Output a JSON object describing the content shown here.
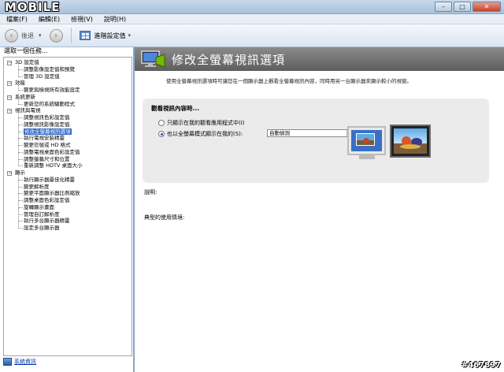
{
  "window": {
    "watermark": "MOBILE",
    "controls": {
      "minimize": "–",
      "maximize": "□",
      "close": "✕"
    }
  },
  "menu": [
    "檔案(F)",
    "編輯(E)",
    "檢視(V)",
    "說明(H)"
  ],
  "toolbar": {
    "back_label": "後退",
    "forward_symbol": "›",
    "back_symbol": "‹",
    "advanced_label": "進階設定值",
    "dropdown_symbol": "▾"
  },
  "sidebar": {
    "header": "選取一個任務...",
    "tree": [
      {
        "type": "cat",
        "label": "3D 設定值",
        "toggle": "−"
      },
      {
        "type": "sub",
        "label": "調整影像設定值和預覽"
      },
      {
        "type": "sub",
        "label": "管理 3D 設定值"
      },
      {
        "type": "cat",
        "label": "效能",
        "toggle": "−"
      },
      {
        "type": "sub",
        "label": "變更與檢視所有效能設定"
      },
      {
        "type": "cat",
        "label": "系統更新",
        "toggle": "−"
      },
      {
        "type": "sub",
        "label": "更新您的系統驅動程式"
      },
      {
        "type": "cat",
        "label": "視訊與電視",
        "toggle": "−"
      },
      {
        "type": "sub",
        "label": "調整視訊色彩設定值"
      },
      {
        "type": "sub",
        "label": "調整視訊影像設定值"
      },
      {
        "type": "sub",
        "label": "修改全螢幕視訊選項",
        "selected": true
      },
      {
        "type": "sub",
        "label": "執行電視安裝精靈"
      },
      {
        "type": "sub",
        "label": "變更信號或 HD 格式"
      },
      {
        "type": "sub",
        "label": "調整電視桌面色彩設定值"
      },
      {
        "type": "sub",
        "label": "調整螢幕尺寸和位置"
      },
      {
        "type": "sub",
        "label": "重新調整 HDTV 桌面大小"
      },
      {
        "type": "cat",
        "label": "顯示",
        "toggle": "−"
      },
      {
        "type": "sub",
        "label": "執行顯示器最佳化精靈"
      },
      {
        "type": "sub",
        "label": "變更解析度"
      },
      {
        "type": "sub",
        "label": "變更平面顯示器比例縮放"
      },
      {
        "type": "sub",
        "label": "調整桌面色彩設定值"
      },
      {
        "type": "sub",
        "label": "旋轉顯示畫面"
      },
      {
        "type": "sub",
        "label": "管理自訂解析度"
      },
      {
        "type": "sub",
        "label": "執行多台顯示器精靈"
      },
      {
        "type": "sub",
        "label": "設定多台顯示器"
      }
    ],
    "system_info": "系統資訊"
  },
  "main": {
    "title": "修改全螢幕視訊選項",
    "description": "使用全螢幕視訊選項時可讓您在一個顯示器上觀看全螢幕視訊內容，同時用另一台顯示器來顯示較小的視窗。",
    "group_title": "觀看視訊內容時...",
    "option1": "只顯示在我的觀看應用程式中(I)",
    "option2": "也以全螢幕模式顯示在我的(S):",
    "select_value": "自動偵測",
    "select_arrow": "▾",
    "description_label": "說明:",
    "usage_label": "典型的使用情境:"
  },
  "footer_mark": "#467897",
  "colors": {
    "header_bg": "#6f6f6f",
    "selection": "#3169c6",
    "nvidia_green": "#76b900"
  }
}
